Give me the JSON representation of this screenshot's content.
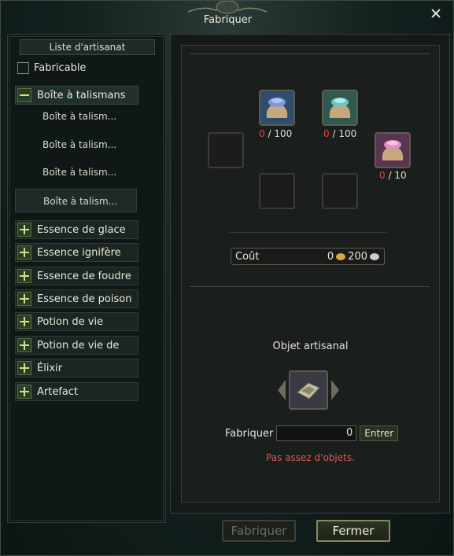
{
  "window": {
    "title": "Fabriquer"
  },
  "left": {
    "header": "Liste d'artisanat",
    "craftable_label": "Fabricable",
    "categories": [
      {
        "label": "Boîte à talismans",
        "expanded": true
      },
      {
        "label": "Essence de glace"
      },
      {
        "label": "Essence ignifère"
      },
      {
        "label": "Essence de foudre"
      },
      {
        "label": "Essence de poison"
      },
      {
        "label": "Potion de vie"
      },
      {
        "label": "Potion de vie de"
      },
      {
        "label": "Élixir"
      },
      {
        "label": "Artefact"
      }
    ],
    "subitems": [
      "Boîte à talism...",
      "Boîte à talism...",
      "Boîte à talism...",
      "Boîte à talism..."
    ]
  },
  "materials": [
    {
      "have": "0",
      "need": "100",
      "icon": "blue-pouch-icon",
      "color": "#6f8fd6"
    },
    {
      "have": "0",
      "need": "100",
      "icon": "teal-pouch-icon",
      "color": "#5fbfbf"
    },
    {
      "have": "0",
      "need": "10",
      "icon": "pink-pouch-icon",
      "color": "#d67fb1"
    }
  ],
  "cost": {
    "label": "Coût",
    "gold": "0",
    "silver": "200"
  },
  "result": {
    "label": "Objet artisanal",
    "icon": "talisman-box-icon"
  },
  "quantity": {
    "label": "Fabriquer",
    "value": "0",
    "enter": "Entrer"
  },
  "warning": "Pas assez d'objets.",
  "buttons": {
    "craft": "Fabriquer",
    "close": "Fermer"
  }
}
